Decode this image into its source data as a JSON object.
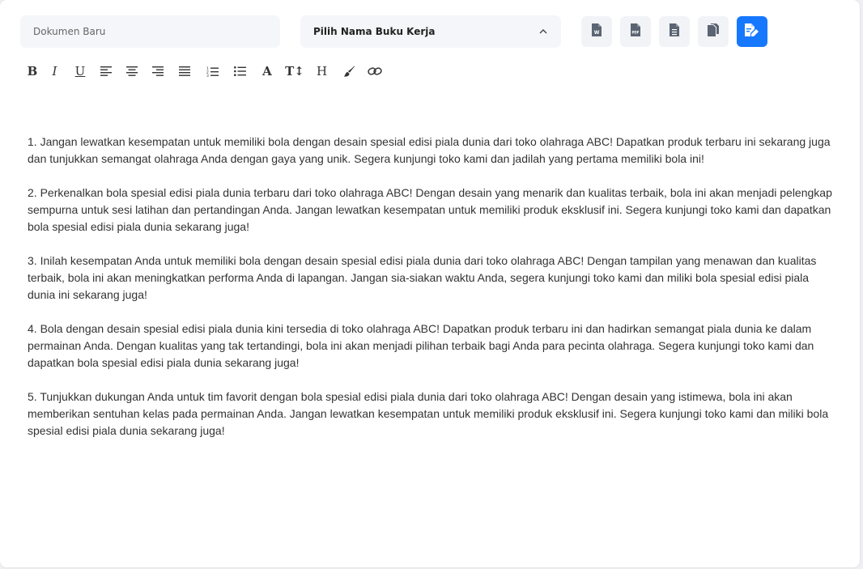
{
  "document": {
    "name_placeholder": "Dokumen Baru",
    "name_value": ""
  },
  "workbook_select": {
    "label": "Pilih Nama Buku Kerja"
  },
  "actions": [
    {
      "name": "export-word-button",
      "icon": "word-file-icon",
      "badge": "W"
    },
    {
      "name": "export-pdf-button",
      "icon": "pdf-file-icon",
      "badge": "PDF"
    },
    {
      "name": "export-text-button",
      "icon": "text-file-icon"
    },
    {
      "name": "copy-button",
      "icon": "copy-icon"
    },
    {
      "name": "save-button",
      "icon": "save-edit-icon",
      "active": true
    }
  ],
  "colors": {
    "primary": "#1677ff",
    "field_bg": "#f4f6f9",
    "button_bg": "#f1f3f6",
    "icon_gray": "#5b6473",
    "text": "#333333"
  },
  "toolbar": {
    "bold": "B",
    "italic": "I",
    "underline": "U",
    "heading": "H",
    "font_color": "A",
    "font_size": "T↕",
    "icons": [
      "bold-icon",
      "italic-icon",
      "underline-icon",
      "align-left-icon",
      "align-center-icon",
      "align-right-icon",
      "align-justify-icon",
      "ordered-list-icon",
      "unordered-list-icon",
      "font-color-icon",
      "font-size-icon",
      "heading-icon",
      "brush-icon",
      "link-icon"
    ]
  },
  "content": {
    "paragraphs": [
      "1. Jangan lewatkan kesempatan untuk memiliki bola dengan desain spesial edisi piala dunia dari toko olahraga ABC! Dapatkan produk terbaru ini sekarang juga dan tunjukkan semangat olahraga Anda dengan gaya yang unik. Segera kunjungi toko kami dan jadilah yang pertama memiliki bola ini!",
      "2. Perkenalkan bola spesial edisi piala dunia terbaru dari toko olahraga ABC! Dengan desain yang menarik dan kualitas terbaik, bola ini akan menjadi pelengkap sempurna untuk sesi latihan dan pertandingan Anda. Jangan lewatkan kesempatan untuk memiliki produk eksklusif ini. Segera kunjungi toko kami dan dapatkan bola spesial edisi piala dunia sekarang juga!",
      "3. Inilah kesempatan Anda untuk memiliki bola dengan desain spesial edisi piala dunia dari toko olahraga ABC! Dengan tampilan yang menawan dan kualitas terbaik, bola ini akan meningkatkan performa Anda di lapangan. Jangan sia-siakan waktu Anda, segera kunjungi toko kami dan miliki bola spesial edisi piala dunia ini sekarang juga!",
      "4. Bola dengan desain spesial edisi piala dunia kini tersedia di toko olahraga ABC! Dapatkan produk terbaru ini dan hadirkan semangat piala dunia ke dalam permainan Anda. Dengan kualitas yang tak tertandingi, bola ini akan menjadi pilihan terbaik bagi Anda para pecinta olahraga. Segera kunjungi toko kami dan dapatkan bola spesial edisi piala dunia sekarang juga!",
      "5. Tunjukkan dukungan Anda untuk tim favorit dengan bola spesial edisi piala dunia dari toko olahraga ABC! Dengan desain yang istimewa, bola ini akan memberikan sentuhan kelas pada permainan Anda. Jangan lewatkan kesempatan untuk memiliki produk eksklusif ini. Segera kunjungi toko kami dan miliki bola spesial edisi piala dunia sekarang juga!"
    ]
  }
}
